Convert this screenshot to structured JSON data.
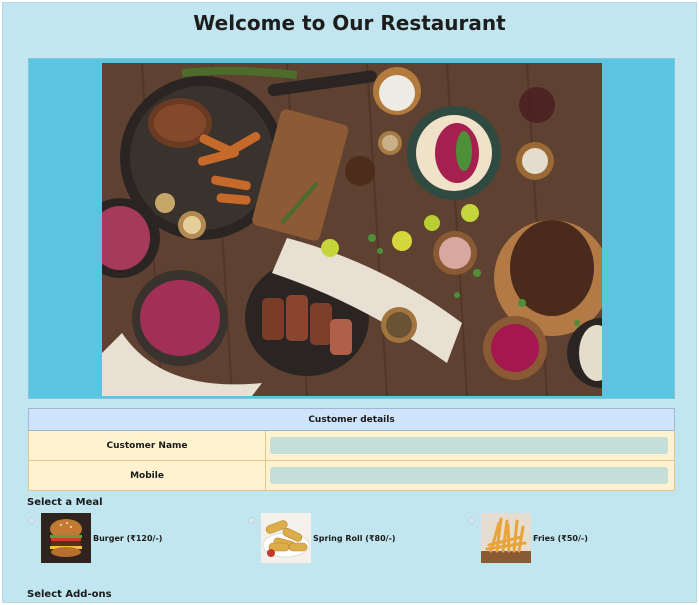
{
  "page": {
    "title": "Welcome to Our Restaurant"
  },
  "hero": {
    "image": "restaurant-food-table-photo"
  },
  "customer_details": {
    "heading": "Customer details",
    "fields": [
      {
        "label": "Customer Name",
        "value": "",
        "placeholder": ""
      },
      {
        "label": "Mobile",
        "value": "",
        "placeholder": ""
      }
    ]
  },
  "meal_section": {
    "label": "Select a Meal",
    "items": [
      {
        "name": "Burger (₹120/-)",
        "icon": "burger-image",
        "selected": false
      },
      {
        "name": "Spring Roll (₹80/-)",
        "icon": "spring-roll-image",
        "selected": false
      },
      {
        "name": "Fries (₹50/-)",
        "icon": "fries-image",
        "selected": false
      }
    ]
  },
  "addons_section": {
    "label": "Select Add-ons"
  },
  "colors": {
    "page_bg": "#c1e6ef",
    "hero_bg": "#5bc4e0",
    "table_header_bg": "#cfe3fb",
    "table_row_bg": "#fff3cf",
    "input_bg": "#c4dfd7"
  }
}
